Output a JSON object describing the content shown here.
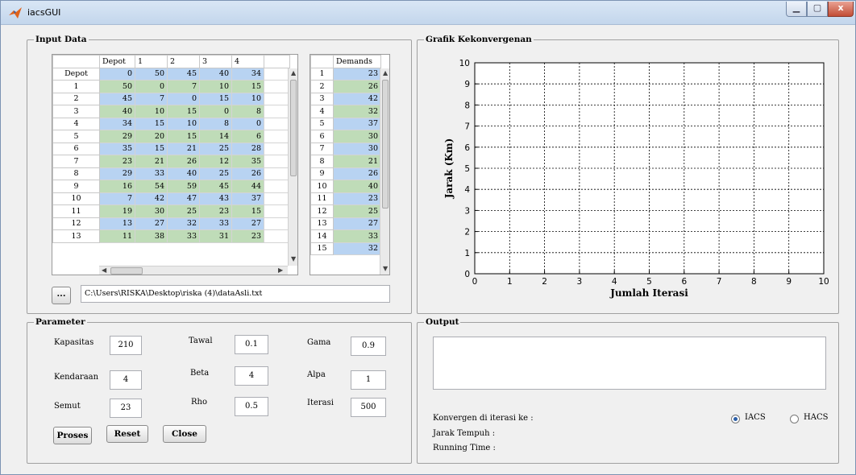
{
  "window": {
    "title": "iacsGUI",
    "min_icon": "minimize-icon",
    "max_icon": "maximize-icon",
    "close_icon": "close-icon",
    "close_label": "x"
  },
  "input_data": {
    "title": "Input Data",
    "distance_columns": [
      "Depot",
      "1",
      "2",
      "3",
      "4"
    ],
    "distance_rows": [
      {
        "label": "Depot",
        "values": [
          "0",
          "50",
          "45",
          "40",
          "34"
        ]
      },
      {
        "label": "1",
        "values": [
          "50",
          "0",
          "7",
          "10",
          "15"
        ]
      },
      {
        "label": "2",
        "values": [
          "45",
          "7",
          "0",
          "15",
          "10"
        ]
      },
      {
        "label": "3",
        "values": [
          "40",
          "10",
          "15",
          "0",
          "8"
        ]
      },
      {
        "label": "4",
        "values": [
          "34",
          "15",
          "10",
          "8",
          "0"
        ]
      },
      {
        "label": "5",
        "values": [
          "29",
          "20",
          "15",
          "14",
          "6"
        ]
      },
      {
        "label": "6",
        "values": [
          "35",
          "15",
          "21",
          "25",
          "28"
        ]
      },
      {
        "label": "7",
        "values": [
          "23",
          "21",
          "26",
          "12",
          "35"
        ]
      },
      {
        "label": "8",
        "values": [
          "29",
          "33",
          "40",
          "25",
          "26"
        ]
      },
      {
        "label": "9",
        "values": [
          "16",
          "54",
          "59",
          "45",
          "44"
        ]
      },
      {
        "label": "10",
        "values": [
          "7",
          "42",
          "47",
          "43",
          "37"
        ]
      },
      {
        "label": "11",
        "values": [
          "19",
          "30",
          "25",
          "23",
          "15"
        ]
      },
      {
        "label": "12",
        "values": [
          "13",
          "27",
          "32",
          "33",
          "27"
        ]
      },
      {
        "label": "13",
        "values": [
          "11",
          "38",
          "33",
          "31",
          "23"
        ]
      }
    ],
    "demand_header": "Demands",
    "demand_rows": [
      {
        "label": "1",
        "value": "23"
      },
      {
        "label": "2",
        "value": "26"
      },
      {
        "label": "3",
        "value": "42"
      },
      {
        "label": "4",
        "value": "32"
      },
      {
        "label": "5",
        "value": "37"
      },
      {
        "label": "6",
        "value": "30"
      },
      {
        "label": "7",
        "value": "30"
      },
      {
        "label": "8",
        "value": "21"
      },
      {
        "label": "9",
        "value": "26"
      },
      {
        "label": "10",
        "value": "40"
      },
      {
        "label": "11",
        "value": "23"
      },
      {
        "label": "12",
        "value": "25"
      },
      {
        "label": "13",
        "value": "27"
      },
      {
        "label": "14",
        "value": "33"
      },
      {
        "label": "15",
        "value": "32"
      }
    ],
    "browse_label": "...",
    "file_path": "C:\\Users\\RISKA\\Desktop\\riska (4)\\dataAsli.txt"
  },
  "chart": {
    "title": "Grafik Kekonvergenan",
    "chart_data": {
      "type": "line",
      "series": [],
      "title": "",
      "xlabel": "Jumlah Iterasi",
      "ylabel": "Jarak (Km)",
      "xlim": [
        0,
        10
      ],
      "ylim": [
        0,
        10
      ],
      "xticks": [
        "0",
        "1",
        "2",
        "3",
        "4",
        "5",
        "6",
        "7",
        "8",
        "9",
        "10"
      ],
      "yticks": [
        "0",
        "1",
        "2",
        "3",
        "4",
        "5",
        "6",
        "7",
        "8",
        "9",
        "10"
      ],
      "grid": true
    }
  },
  "parameter": {
    "title": "Parameter",
    "fields": [
      {
        "label": "Kapasitas",
        "value": "210"
      },
      {
        "label": "Kendaraan",
        "value": "4"
      },
      {
        "label": "Semut",
        "value": "23"
      },
      {
        "label": "Tawal",
        "value": "0.1"
      },
      {
        "label": "Beta",
        "value": "4"
      },
      {
        "label": "Rho",
        "value": "0.5"
      },
      {
        "label": "Gama",
        "value": "0.9"
      },
      {
        "label": "Alpa",
        "value": "1"
      },
      {
        "label": "Iterasi",
        "value": "500"
      }
    ],
    "buttons": {
      "proses": "Proses",
      "reset": "Reset",
      "close": "Close"
    }
  },
  "output": {
    "title": "Output",
    "text": "",
    "konvergen_label": "Konvergen di iterasi ke :",
    "jarak_label": "Jarak Tempuh :",
    "time_label": "Running Time :",
    "radio_iacs": "IACS",
    "radio_hacs": "HACS",
    "selected": "IACS"
  }
}
